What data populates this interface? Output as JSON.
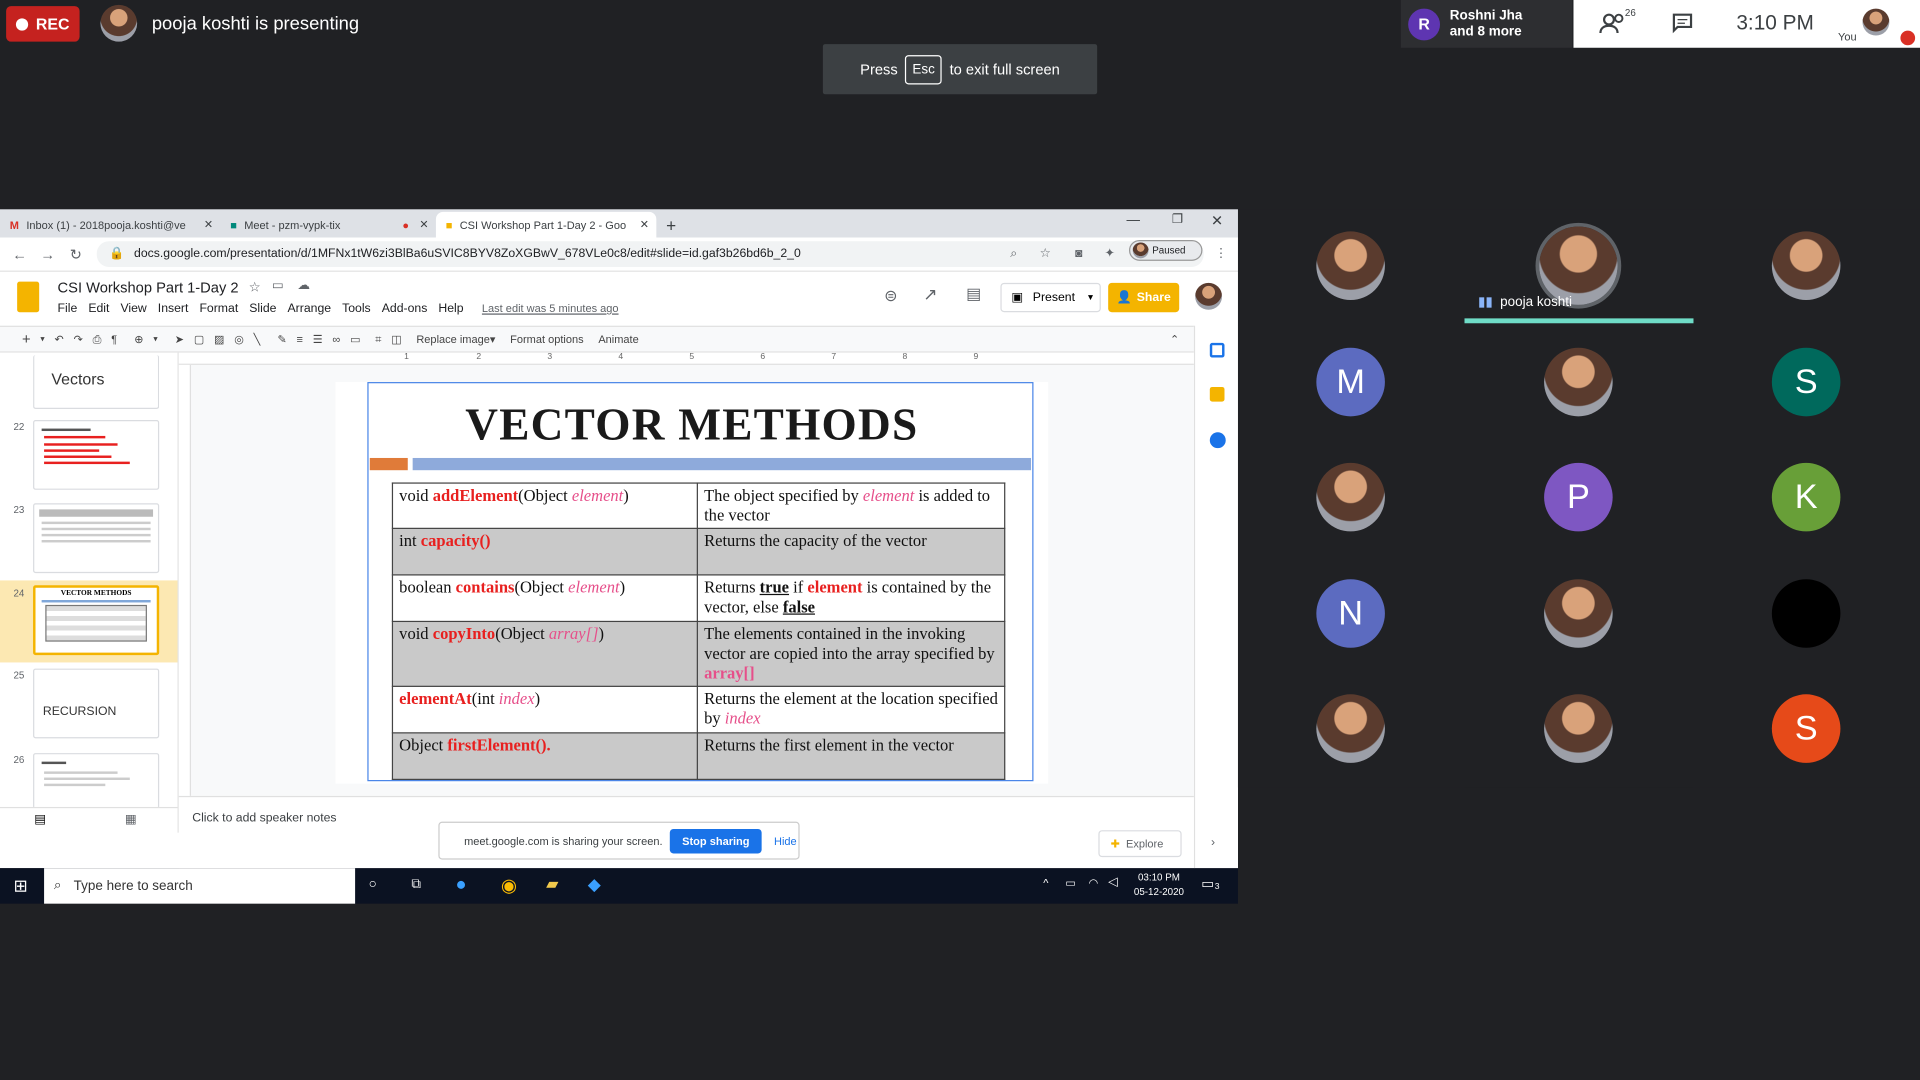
{
  "meet": {
    "rec_label": "REC",
    "presenting_text": "pooja koshti is presenting",
    "fullscreen_hint": {
      "pre": "Press",
      "key": "Esc",
      "post": "to exit full screen"
    },
    "people_summary": {
      "initial": "R",
      "line1": "Roshni Jha",
      "line2": "and 8 more"
    },
    "participant_count": "26",
    "clock": "3:10 PM",
    "you_label": "You",
    "speaker_name": "pooja koshti",
    "colors": {
      "rec": "#c5221f",
      "accent": "#1a73e8"
    },
    "tiles": [
      {
        "type": "photo"
      },
      {
        "type": "photo",
        "speaking": true
      },
      {
        "type": "photo"
      },
      {
        "type": "letter",
        "letter": "M",
        "color": "#5c6bc0"
      },
      {
        "type": "photo"
      },
      {
        "type": "letter",
        "letter": "S",
        "color": "#00695c"
      },
      {
        "type": "photo"
      },
      {
        "type": "letter",
        "letter": "P",
        "color": "#7e57c2"
      },
      {
        "type": "letter",
        "letter": "K",
        "color": "#689f38"
      },
      {
        "type": "letter",
        "letter": "N",
        "color": "#5c6bc0"
      },
      {
        "type": "photo"
      },
      {
        "type": "blank",
        "color": "#000000"
      },
      {
        "type": "photo"
      },
      {
        "type": "photo"
      },
      {
        "type": "letter",
        "letter": "S",
        "color": "#e64a19"
      },
      {
        "type": "photo"
      }
    ]
  },
  "browser": {
    "tabs": [
      {
        "title": "Inbox (1) - 2018pooja.koshti@ve",
        "icon": "gmail-icon"
      },
      {
        "title": "Meet - pzm-vypk-tix",
        "icon": "meet-icon"
      },
      {
        "title": "CSI Workshop Part 1-Day 2 - Goo",
        "icon": "slides-icon",
        "active": true
      }
    ],
    "url": "docs.google.com/presentation/d/1MFNx1tW6zi3BlBa6uSVIC8BYV8ZoXGBwV_678VLe0c8/edit#slide=id.gaf3b26bd6b_2_0",
    "paused_label": "Paused"
  },
  "slides_app": {
    "doc_title": "CSI Workshop Part 1-Day 2",
    "menu": [
      "File",
      "Edit",
      "View",
      "Insert",
      "Format",
      "Slide",
      "Arrange",
      "Tools",
      "Add-ons",
      "Help"
    ],
    "last_edit": "Last edit was 5 minutes ago",
    "present_label": "Present",
    "share_label": "Share",
    "toolbar_text": [
      "Replace image",
      "Format options",
      "Animate"
    ],
    "ruler": [
      "1",
      "2",
      "3",
      "4",
      "5",
      "6",
      "7",
      "8",
      "9"
    ],
    "filmstrip": {
      "top_title": "Vectors",
      "slides": [
        {
          "num": "22",
          "kind": "text"
        },
        {
          "num": "23",
          "kind": "table"
        },
        {
          "num": "24",
          "kind": "current",
          "title": "VECTOR METHODS"
        },
        {
          "num": "25",
          "kind": "title",
          "title": "RECURSION"
        },
        {
          "num": "26",
          "kind": "text"
        }
      ]
    },
    "speaker_notes": "Click to add speaker notes",
    "explore_label": "Explore",
    "slide": {
      "title": "VECTOR METHODS",
      "rows": [
        {
          "m_pre": "void ",
          "m_red": "addElement",
          "m_mid": "(Object ",
          "m_it": "element",
          "m_post": ")",
          "d_parts": [
            {
              "t": "The object specified by "
            },
            {
              "t": "element",
              "c": "pink"
            },
            {
              "t": " is added to the vector"
            }
          ]
        },
        {
          "m_pre": "int ",
          "m_red": "capacity()",
          "m_mid": "",
          "m_it": "",
          "m_post": "",
          "d_parts": [
            {
              "t": "Returns the capacity of the vector"
            }
          ]
        },
        {
          "m_pre": "boolean ",
          "m_red": "contains",
          "m_mid": "(Object ",
          "m_it": "element",
          "m_post": ")",
          "d_parts": [
            {
              "t": "Returns "
            },
            {
              "t": "true",
              "c": "ul"
            },
            {
              "t": " if "
            },
            {
              "t": "element",
              "c": "red"
            },
            {
              "t": " is contained by the vector, else "
            },
            {
              "t": "false",
              "c": "ul"
            }
          ]
        },
        {
          "m_pre": "void ",
          "m_red": "copyInto",
          "m_mid": "(Object ",
          "m_it": "array[]",
          "m_post": ")",
          "d_parts": [
            {
              "t": "The elements contained in the invoking vector are copied into the array specified by "
            },
            {
              "t": "array[]",
              "c": "pinkb"
            }
          ]
        },
        {
          "m_pre": "",
          "m_red": "elementAt",
          "m_mid": "(int ",
          "m_it": "index",
          "m_post": ")",
          "d_parts": [
            {
              "t": "Returns the element at the location specified by "
            },
            {
              "t": "index",
              "c": "pink"
            }
          ]
        },
        {
          "m_pre": "Object ",
          "m_red": "firstElement().",
          "m_mid": "",
          "m_it": "",
          "m_post": "",
          "d_parts": [
            {
              "t": "Returns the first element in the vector"
            }
          ]
        }
      ]
    }
  },
  "sharing_bar": {
    "text": "meet.google.com is sharing your screen.",
    "stop_label": "Stop sharing",
    "hide_label": "Hide"
  },
  "taskbar": {
    "search_placeholder": "Type here to search",
    "time": "03:10 PM",
    "date": "05-12-2020",
    "notif_count": "3"
  }
}
